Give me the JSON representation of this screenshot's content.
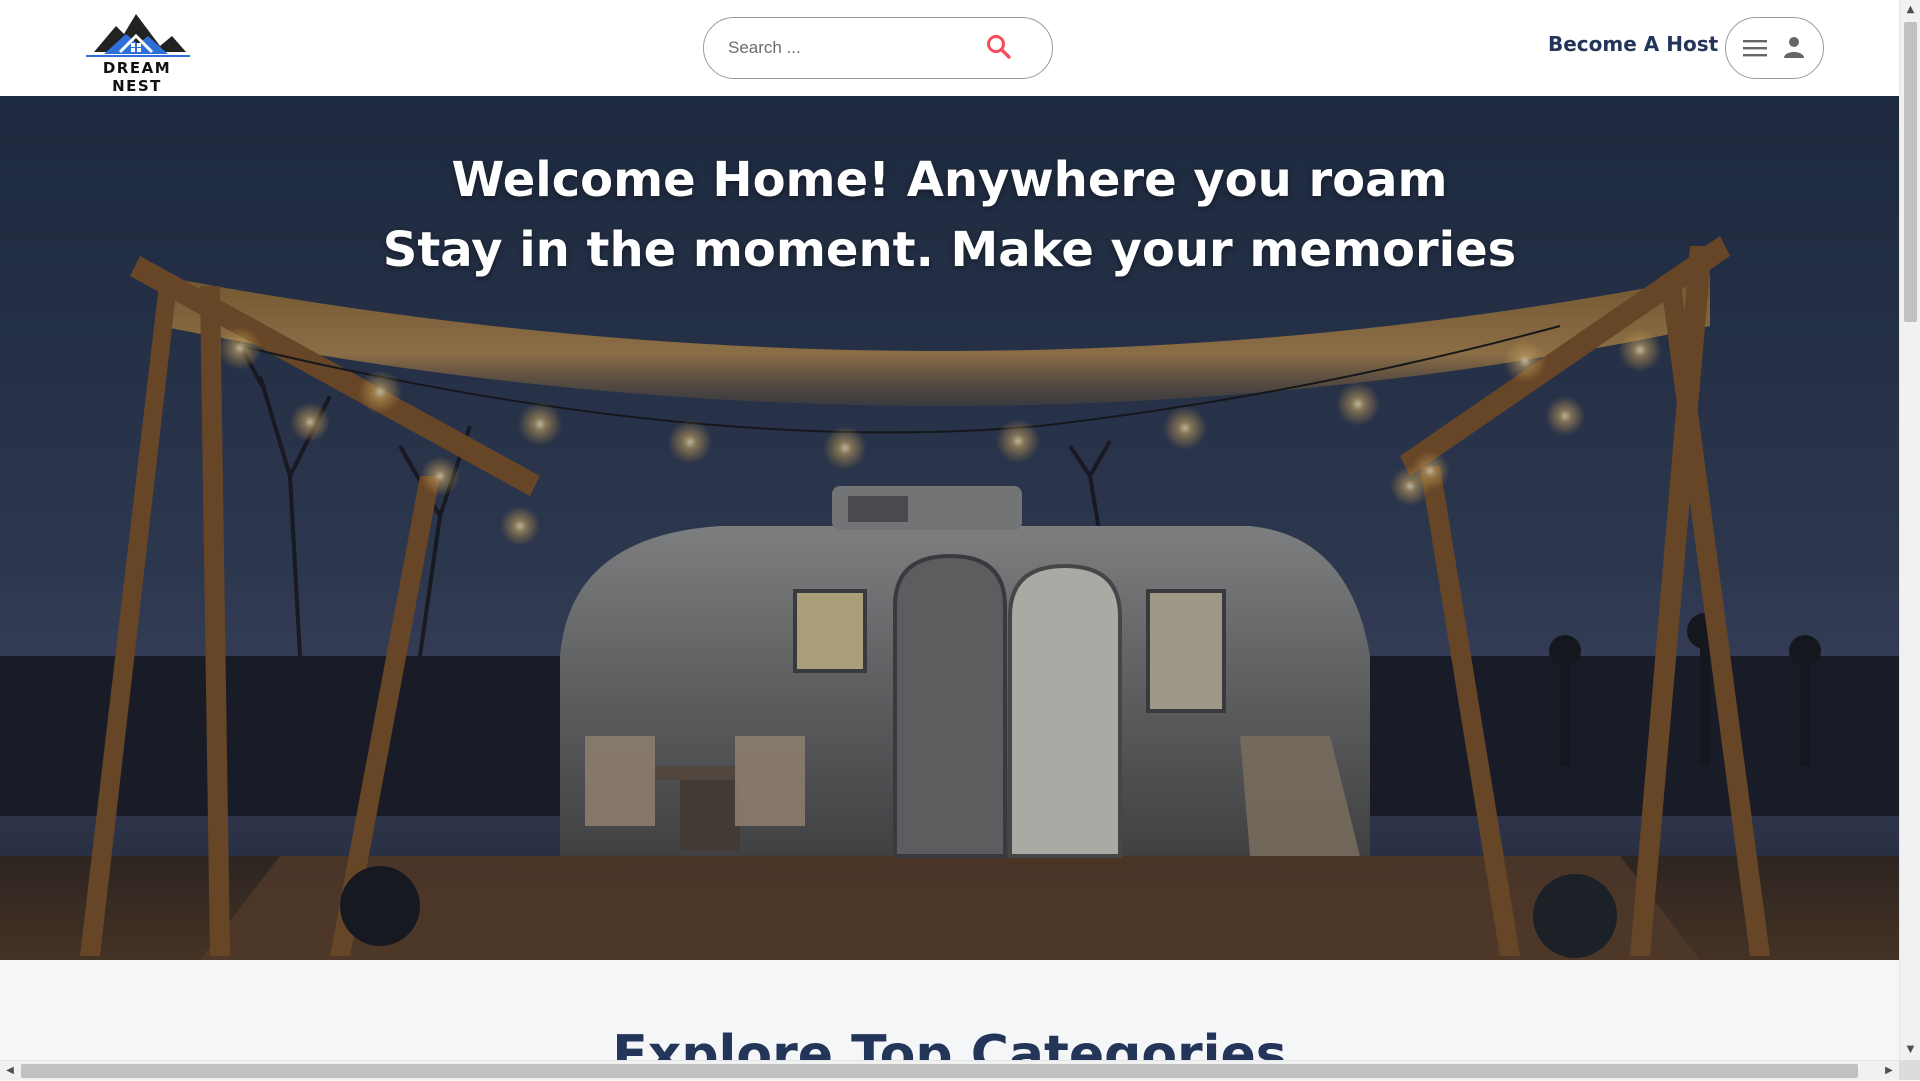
{
  "brand": {
    "name": "DREAM NEST"
  },
  "search": {
    "placeholder": "Search ..."
  },
  "nav": {
    "host_label": "Become A Host"
  },
  "hero": {
    "line1": "Welcome Home! Anywhere you roam",
    "line2": "Stay in the moment. Make your memories"
  },
  "section": {
    "title": "Explore Top Categories"
  },
  "icons": {
    "search": "search-icon",
    "menu": "menu-icon",
    "user": "user-icon",
    "logo": "house-mountain-logo"
  },
  "colors": {
    "accent": "#F24E5E",
    "navy": "#24355A",
    "logo_blue": "#2E6FD8"
  },
  "scroll": {
    "up": "▲",
    "down": "▼",
    "left": "◀",
    "right": "▶"
  }
}
